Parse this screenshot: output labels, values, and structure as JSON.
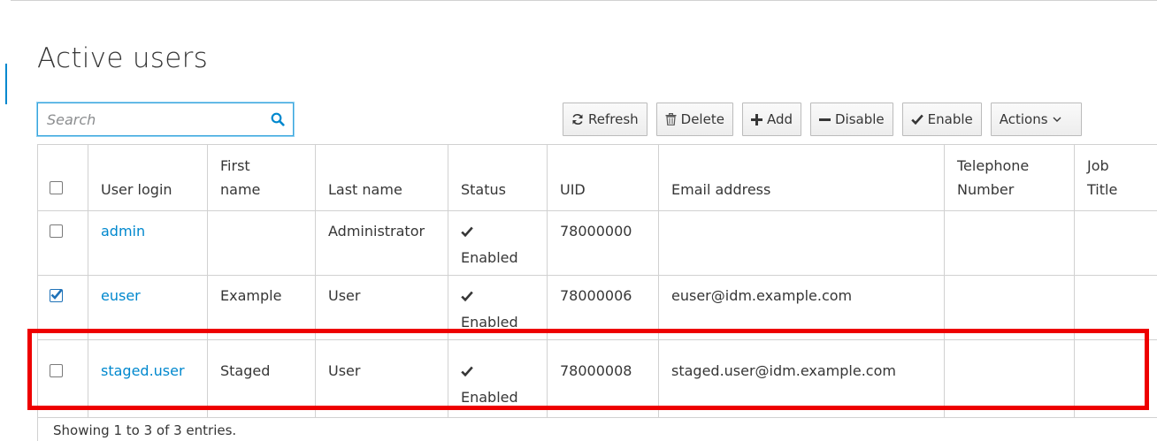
{
  "page": {
    "title": "Active users"
  },
  "search": {
    "placeholder": "Search",
    "value": ""
  },
  "toolbar": {
    "refresh_label": "Refresh",
    "delete_label": "Delete",
    "add_label": "Add",
    "disable_label": "Disable",
    "enable_label": "Enable",
    "actions_label": "Actions"
  },
  "table": {
    "columns": {
      "login": "User login",
      "first_name_1": "First",
      "first_name_2": "name",
      "last_name": "Last name",
      "status": "Status",
      "uid": "UID",
      "email": "Email address",
      "telephone_1": "Telephone",
      "telephone_2": "Number",
      "job_1": "Job",
      "job_2": "Title"
    },
    "rows": [
      {
        "checked": false,
        "login": "admin",
        "first_name": "",
        "last_name": "Administrator",
        "status": "Enabled",
        "uid": "78000000",
        "email": "",
        "telephone": "",
        "job_title": ""
      },
      {
        "checked": true,
        "login": "euser",
        "first_name": "Example",
        "last_name": "User",
        "status": "Enabled",
        "uid": "78000006",
        "email": "euser@idm.example.com",
        "telephone": "",
        "job_title": ""
      },
      {
        "checked": false,
        "login": "staged.user",
        "first_name": "Staged",
        "last_name": "User",
        "status": "Enabled",
        "uid": "78000008",
        "email": "staged.user@idm.example.com",
        "telephone": "",
        "job_title": ""
      }
    ]
  },
  "footer": {
    "summary": "Showing 1 to 3 of 3 entries."
  },
  "colors": {
    "link": "#0088ce",
    "highlight": "#ee0000",
    "border": "#d1d1d1"
  }
}
